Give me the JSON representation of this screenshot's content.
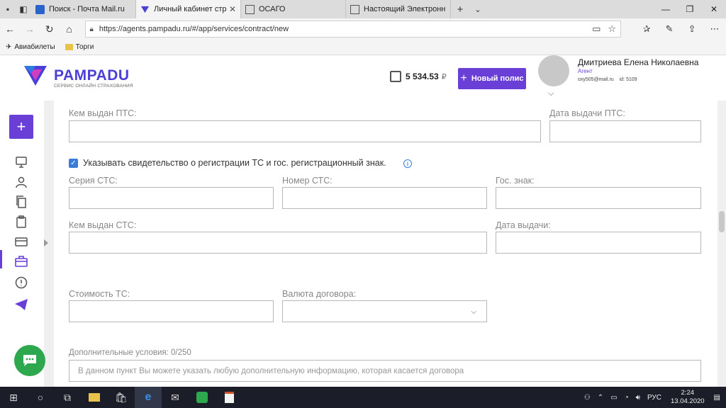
{
  "browser": {
    "tabs": [
      {
        "title": "Поиск - Почта Mail.ru",
        "active": false
      },
      {
        "title": "Личный кабинет страх",
        "active": true
      },
      {
        "title": "ОСАГО",
        "active": false
      },
      {
        "title": "Настоящий Электронный Г",
        "active": false
      }
    ],
    "url": "https://agents.pampadu.ru/#/app/services/contract/new",
    "favorites": [
      "Авиабилеты",
      "Торги"
    ]
  },
  "header": {
    "logo_name": "PAMPADU",
    "logo_sub": "СЕРВИС ОНЛАЙН СТРАХОВАНИЯ",
    "balance_amount": "5 534.53",
    "balance_currency": "₽",
    "new_policy_label": "Новый полис",
    "user_name": "Дмитриева Елена Николаевна",
    "user_role": "Агент",
    "user_email": "oxy505@mail.ru",
    "user_id": "id: 5109"
  },
  "form": {
    "pts_issued_by_label": "Кем выдан ПТС:",
    "pts_issue_date_label": "Дата выдачи ПТС:",
    "sts_checkbox_label": "Указывать свидетельство о регистрации ТС и гос. регистрационный знак.",
    "sts_checkbox_checked": true,
    "sts_series_label": "Серия СТС:",
    "sts_number_label": "Номер СТС:",
    "plate_label": "Гос. знак:",
    "sts_issued_by_label": "Кем выдан СТС:",
    "sts_issue_date_label": "Дата выдачи:",
    "vehicle_cost_label": "Стоимость ТС:",
    "contract_currency_label": "Валюта договора:",
    "contract_currency_value": "",
    "additional_label": "Дополнительные условия:",
    "additional_counter": "0/250",
    "additional_placeholder": "В данном пункт Вы можете указать любую дополнительную информацию, которая касается договора"
  },
  "taskbar": {
    "language": "РУС",
    "time": "2:24",
    "date": "13.04.2020"
  },
  "colors": {
    "brand": "#6a3fd8",
    "chat": "#2ea84f",
    "checkbox": "#3a7dd8"
  }
}
